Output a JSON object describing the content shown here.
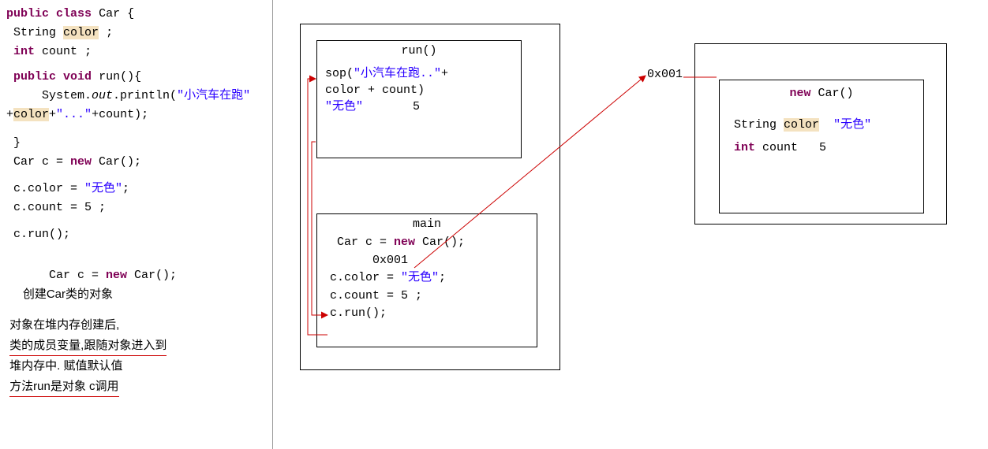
{
  "code": {
    "kw_public": "public",
    "kw_class": "class",
    "kw_void": "void",
    "kw_new": "new",
    "kw_int": "int",
    "type_String": "String",
    "cls_Car": "Car",
    "brace_open": "{",
    "brace_close": "}",
    "fld_color": "color",
    "fld_count": "count",
    "semicolon": ";",
    "method_run": "run()",
    "obj_System": "System.",
    "out": "out",
    "println": ".println(",
    "str_1": "\"小汽车在跑\"",
    "plus_color": "+color+",
    "str_dots": "\"...\"",
    "plus_count": "+count);",
    "decl_c": "Car c = ",
    "new_car": " Car();",
    "assign_color": "c.color = ",
    "val_color": "\"无色\"",
    "semi": ";",
    "assign_count": "c.count = 5 ;",
    "call_run": "c.run();",
    "note_create1": "Car c = ",
    "note_create_new": " Car();",
    "note_create2": "创建Car类的对象",
    "paragraph_1": "对象在堆内存创建后,",
    "paragraph_2": "类的成员变量,跟随对象进入到",
    "paragraph_3": "堆内存中. 赋值默认值",
    "paragraph_4": "方法run是对象 c调用"
  },
  "stack": {
    "run": {
      "title": "run()",
      "line1a": "sop(",
      "line1b": "\"小汽车在跑..\"",
      "line1c": "+",
      "line2": "color +   count)",
      "valcolor": "\"无色\"",
      "valcount": "5"
    },
    "main": {
      "title": "main",
      "line1a": "Car c = ",
      "line1b": " Car();",
      "addr": "0x001",
      "line3a": "c.color = ",
      "line3b": "\"无色\"",
      "line3c": ";",
      "line4": "c.count = 5 ;",
      "line5": "c.run();"
    }
  },
  "heap": {
    "addr": "0x001",
    "car": {
      "title_new": "new",
      "title_rest": " Car()",
      "f1_type": "String",
      "f1_name": "color",
      "f1_val": "\"无色\"",
      "f2_type": "int",
      "f2_name": " count",
      "f2_val": "   5"
    }
  }
}
